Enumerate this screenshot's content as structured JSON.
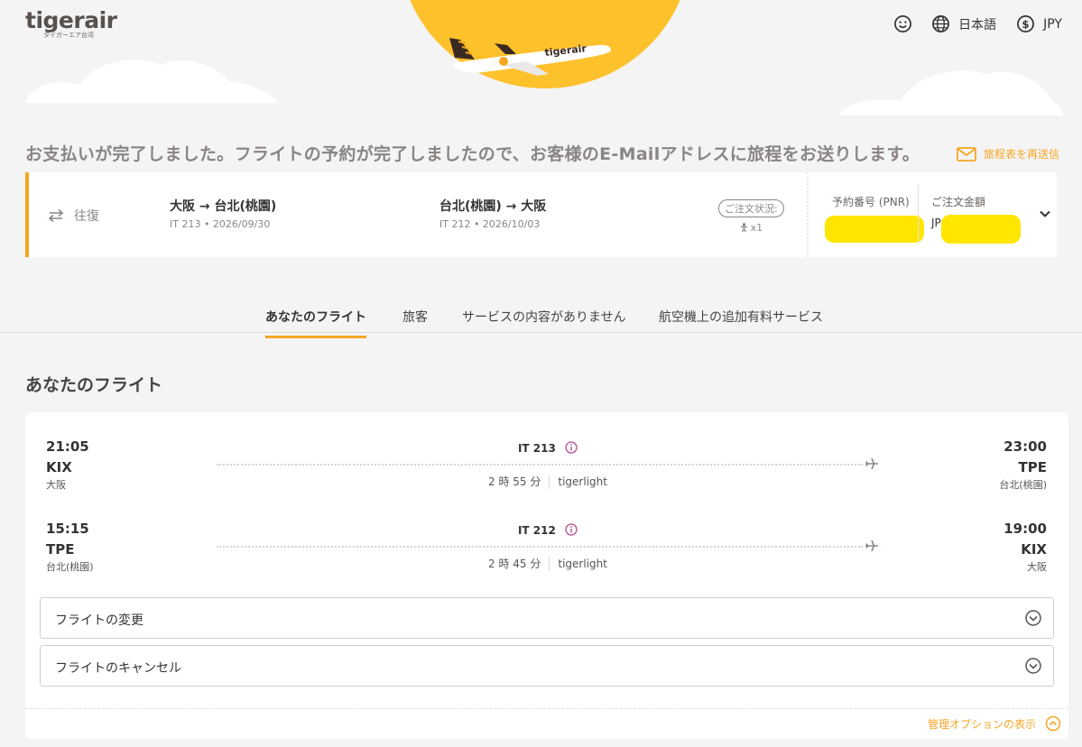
{
  "brand": {
    "logo_text": "tigerair",
    "logo_subtext": "タイガーエア台湾",
    "accent_color": "#f5a623",
    "sun_color": "#fdc12c",
    "highlight_color": "#ffe600"
  },
  "header": {
    "account_icon": "smiley-icon",
    "language_icon": "globe-icon",
    "language": "日本語",
    "currency_icon": "dollar-circle-icon",
    "currency": "JPY"
  },
  "confirmation": {
    "message": "お支払いが完了しました。フライトの予約が完了しましたので、お客様のE-Mailアドレスに旅程をお送りします。",
    "resend_label": "旅程表を再送信",
    "resend_icon": "mail-icon"
  },
  "booking": {
    "trip_type": "往復",
    "trip_type_icon": "swap-arrows-icon",
    "outbound": {
      "route": "大阪 → 台北(桃園)",
      "info": "IT 213 • 2026/09/30"
    },
    "inbound": {
      "route": "台北(桃園) → 大阪",
      "info": "IT 212 • 2026/10/03"
    },
    "order_status_label": "ご注文状況:",
    "passenger_count": "x1",
    "pnr_label": "予約番号 (PNR)",
    "amount_label": "ご注文金額",
    "amount_currency": "JP"
  },
  "tabs": [
    {
      "label": "あなたのフライト",
      "active": true
    },
    {
      "label": "旅客",
      "active": false
    },
    {
      "label": "サービスの内容がありません",
      "active": false
    },
    {
      "label": "航空機上の追加有料サービス",
      "active": false
    }
  ],
  "section_title": "あなたのフライト",
  "flights": [
    {
      "dep_time": "21:05",
      "dep_code": "KIX",
      "dep_city": "大阪",
      "flight_no": "IT 213",
      "duration": "2 時 55 分",
      "fare": "tigerlight",
      "arr_time": "23:00",
      "arr_code": "TPE",
      "arr_city": "台北(桃園)"
    },
    {
      "dep_time": "15:15",
      "dep_code": "TPE",
      "dep_city": "台北(桃園)",
      "flight_no": "IT 212",
      "duration": "2 時 45 分",
      "fare": "tigerlight",
      "arr_time": "19:00",
      "arr_code": "KIX",
      "arr_city": "大阪"
    }
  ],
  "actions": {
    "change_flight": "フライトの変更",
    "cancel_flight": "フライトのキャンセル",
    "manage_options": "管理オプションの表示"
  }
}
